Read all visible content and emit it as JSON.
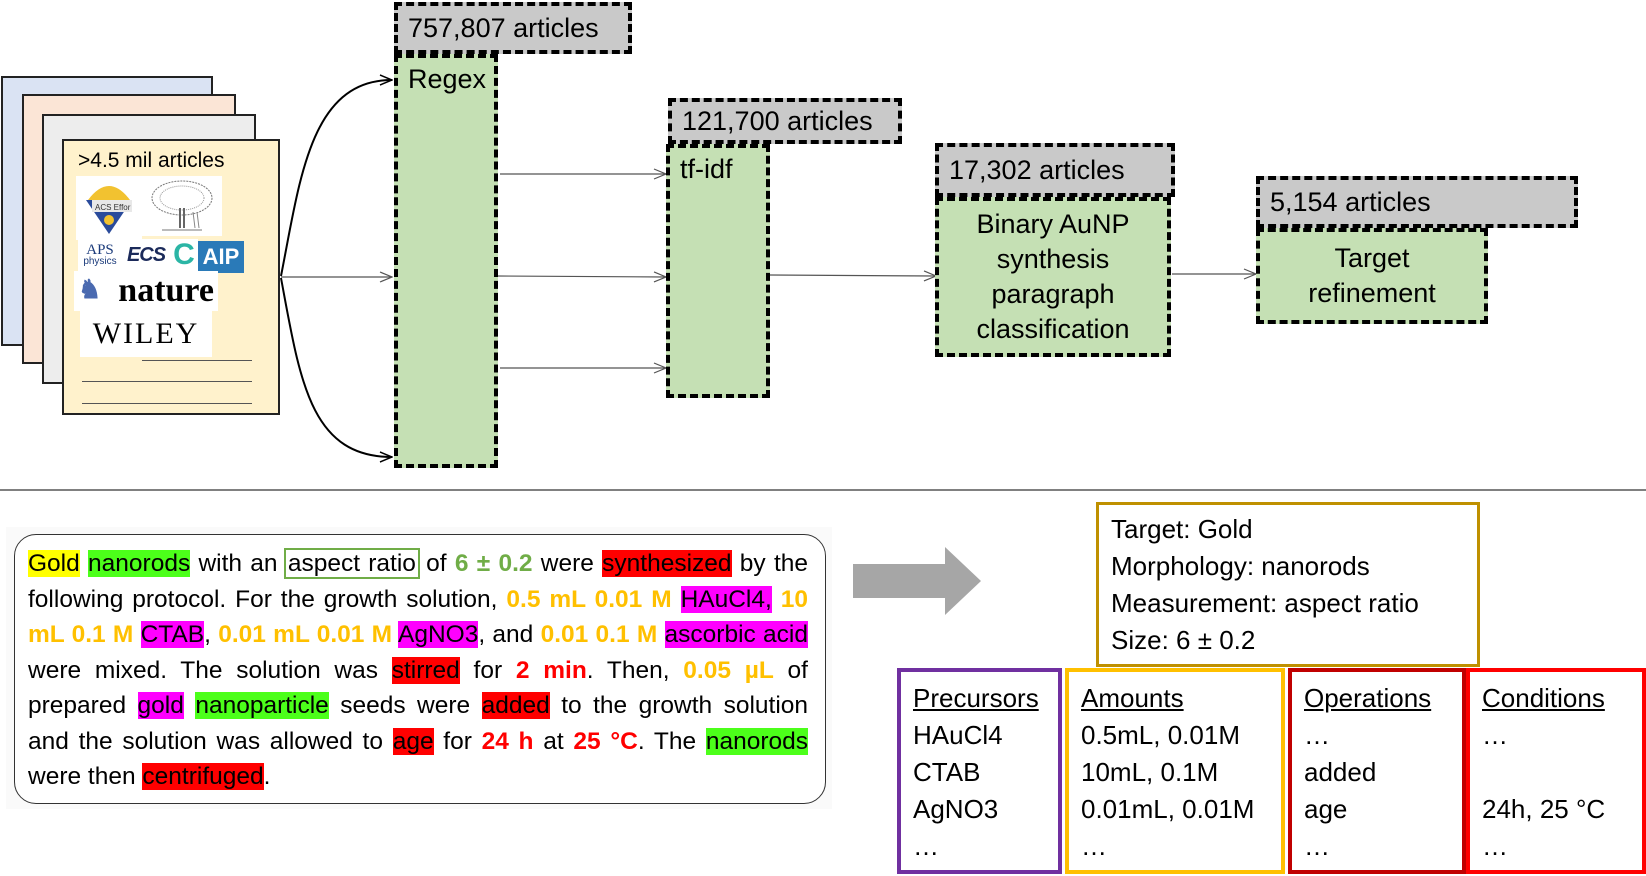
{
  "corpus": {
    "title": ">4.5 mil articles",
    "publishers": [
      "ACS",
      "Elsevier",
      "APS physics",
      "ECS",
      "C",
      "AIP",
      "nature",
      "WILEY"
    ],
    "acs_logo_text": "ACS Effor",
    "aps_logo_text": "APS",
    "aps_logo_sub": "physics",
    "ecs_logo_text": "ECS",
    "c_logo_text": "C",
    "aip_logo_text": "AIP",
    "nature_logo_text": "nature",
    "wiley_logo_text": "WILEY"
  },
  "pipeline": [
    {
      "count": "757,807 articles",
      "stage": "Regex"
    },
    {
      "count": "121,700 articles",
      "stage": "tf-idf"
    },
    {
      "count": "17,302 articles",
      "stage": "Binary AuNP synthesis paragraph classification",
      "stage_lines": [
        "Binary AuNP",
        "synthesis",
        "paragraph",
        "classification"
      ]
    },
    {
      "count": "5,154 articles",
      "stage": "Target refinement",
      "stage_lines": [
        "Target",
        "refinement"
      ]
    }
  ],
  "paragraph": {
    "segments": [
      {
        "text": "Gold",
        "tag": "target"
      },
      {
        "text": " ",
        "tag": "plain"
      },
      {
        "text": "nanorods",
        "tag": "morphology"
      },
      {
        "text": " with an ",
        "tag": "plain"
      },
      {
        "text": "aspect ratio",
        "tag": "measurement"
      },
      {
        "text": " of ",
        "tag": "plain"
      },
      {
        "text": "6 ± 0.2",
        "tag": "size"
      },
      {
        "text": " were ",
        "tag": "plain"
      },
      {
        "text": "synthesized",
        "tag": "operation"
      },
      {
        "text": " by the following protocol. For the growth solution, ",
        "tag": "plain"
      },
      {
        "text": "0.5 mL 0.01 M",
        "tag": "amount"
      },
      {
        "text": " ",
        "tag": "plain"
      },
      {
        "text": "HAuCl4,",
        "tag": "precursor"
      },
      {
        "text": " ",
        "tag": "plain"
      },
      {
        "text": "10 mL 0.1 M",
        "tag": "amount"
      },
      {
        "text": " ",
        "tag": "plain"
      },
      {
        "text": "CTAB",
        "tag": "precursor"
      },
      {
        "text": ", ",
        "tag": "plain"
      },
      {
        "text": "0.01 mL 0.01 M",
        "tag": "amount"
      },
      {
        "text": " ",
        "tag": "plain"
      },
      {
        "text": "AgNO3",
        "tag": "precursor"
      },
      {
        "text": ", and ",
        "tag": "plain"
      },
      {
        "text": "0.01 0.1 M",
        "tag": "amount"
      },
      {
        "text": " ",
        "tag": "plain"
      },
      {
        "text": "ascorbic acid",
        "tag": "precursor"
      },
      {
        "text": " were mixed. The solution was ",
        "tag": "plain"
      },
      {
        "text": "stirred",
        "tag": "operation"
      },
      {
        "text": " for ",
        "tag": "plain"
      },
      {
        "text": "2 min",
        "tag": "condition"
      },
      {
        "text": ". Then, ",
        "tag": "plain"
      },
      {
        "text": "0.05 µL",
        "tag": "amount"
      },
      {
        "text": " of prepared ",
        "tag": "plain"
      },
      {
        "text": "gold",
        "tag": "precursor"
      },
      {
        "text": " ",
        "tag": "plain"
      },
      {
        "text": "nanoparticle",
        "tag": "morphology"
      },
      {
        "text": " seeds were ",
        "tag": "plain"
      },
      {
        "text": "added",
        "tag": "operation"
      },
      {
        "text": " to the growth solution and the solution was allowed to ",
        "tag": "plain"
      },
      {
        "text": "age",
        "tag": "operation"
      },
      {
        "text": " for ",
        "tag": "plain"
      },
      {
        "text": "24 h",
        "tag": "condition"
      },
      {
        "text": " at ",
        "tag": "plain"
      },
      {
        "text": "25 °C",
        "tag": "condition"
      },
      {
        "text": ". The ",
        "tag": "plain"
      },
      {
        "text": "nanorods",
        "tag": "morphology"
      },
      {
        "text": " were then ",
        "tag": "plain"
      },
      {
        "text": "centrifuged",
        "tag": "operation"
      },
      {
        "text": ".",
        "tag": "plain"
      }
    ]
  },
  "summary": {
    "target": "Target: Gold",
    "morphology": "Morphology: nanorods",
    "measurement": "Measurement: aspect ratio",
    "size": "Size: 6 ± 0.2"
  },
  "extraction": {
    "precursors": {
      "header": "Precursors",
      "rows": [
        "HAuCl4",
        "CTAB",
        "AgNO3",
        "…"
      ]
    },
    "amounts": {
      "header": "Amounts",
      "rows": [
        "0.5mL, 0.01M",
        "10mL, 0.1M",
        "0.01mL, 0.01M",
        "…"
      ]
    },
    "operations": {
      "header": "Operations",
      "rows": [
        "…",
        "added",
        "age",
        "…"
      ]
    },
    "conditions": {
      "header": "Conditions",
      "rows": [
        "…",
        "",
        "24h, 25 °C",
        "…"
      ]
    }
  },
  "colors": {
    "count_box": "#c9c9c9",
    "stage_box": "#c5e0b4",
    "target_highlight": "#ffff00",
    "morphology_highlight": "#4cff1a",
    "precursor_highlight": "#ff00ff",
    "operation_highlight": "#ff0000",
    "amount_text": "#ffc000",
    "condition_text": "#ff0000",
    "size_text": "#70ad47",
    "precursors_border": "#7030a0",
    "amounts_border": "#ffc000",
    "operations_border": "#c00000",
    "conditions_border": "#ff0000",
    "summary_border": "#bf9000"
  }
}
